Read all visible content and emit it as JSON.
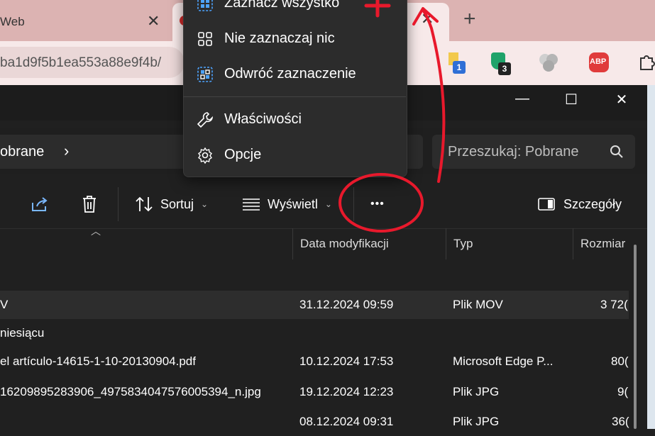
{
  "browser": {
    "tab_left_title": "Web",
    "tab_close": "✕",
    "new_tab": "+",
    "address": "ba1d9f5b1ea553a88e9f4b/",
    "extensions": [
      {
        "name": "yellow-ext-icon",
        "badge": "1",
        "color": "#f2c94c"
      },
      {
        "name": "shield-ext-icon",
        "badge": "3",
        "color": "#1fa36a"
      },
      {
        "name": "circles-ext-icon",
        "badge": "",
        "color": "#bbbbbb"
      },
      {
        "name": "adblock-ext-icon",
        "badge": "ABP",
        "color": "#e03b3b"
      },
      {
        "name": "puzzle-ext-icon",
        "badge": "",
        "color": "#333333"
      }
    ]
  },
  "explorer": {
    "window_buttons": {
      "minimize": "—",
      "maximize": "☐",
      "close": "✕"
    },
    "breadcrumb": "obrane",
    "search_placeholder": "Przeszukaj: Pobrane",
    "toolbar": {
      "sort": "Sortuj",
      "view": "Wyświetl",
      "more": "•••",
      "details": "Szczegóły"
    },
    "columns": [
      "Data modyfikacji",
      "Typ",
      "Rozmiar"
    ],
    "rows": [
      {
        "name": "V",
        "date": "31.12.2024 09:59",
        "type": "Plik MOV",
        "size": "3 72("
      },
      {
        "group": "niesiącu"
      },
      {
        "name": "el artículo-14615-1-10-20130904.pdf",
        "date": "10.12.2024 17:53",
        "type": "Microsoft Edge P...",
        "size": "80("
      },
      {
        "name": "16209895283906_4975834047576005394_n.jpg",
        "date": "19.12.2024 12:23",
        "type": "Plik JPG",
        "size": "9("
      },
      {
        "name": "",
        "date": "08.12.2024 09:31",
        "type": "Plik JPG",
        "size": "36("
      }
    ]
  },
  "context_menu": {
    "items": [
      {
        "label": "Zaznacz wszystko",
        "icon": "select-all-icon"
      },
      {
        "label": "Nie zaznaczaj nic",
        "icon": "select-none-icon"
      },
      {
        "label": "Odwróć zaznaczenie",
        "icon": "invert-selection-icon"
      },
      {
        "label": "Właściwości",
        "icon": "wrench-icon"
      },
      {
        "label": "Opcje",
        "icon": "gear-icon"
      }
    ]
  },
  "colors": {
    "annotation": "#e8192c",
    "accent": "#4da3ff"
  }
}
